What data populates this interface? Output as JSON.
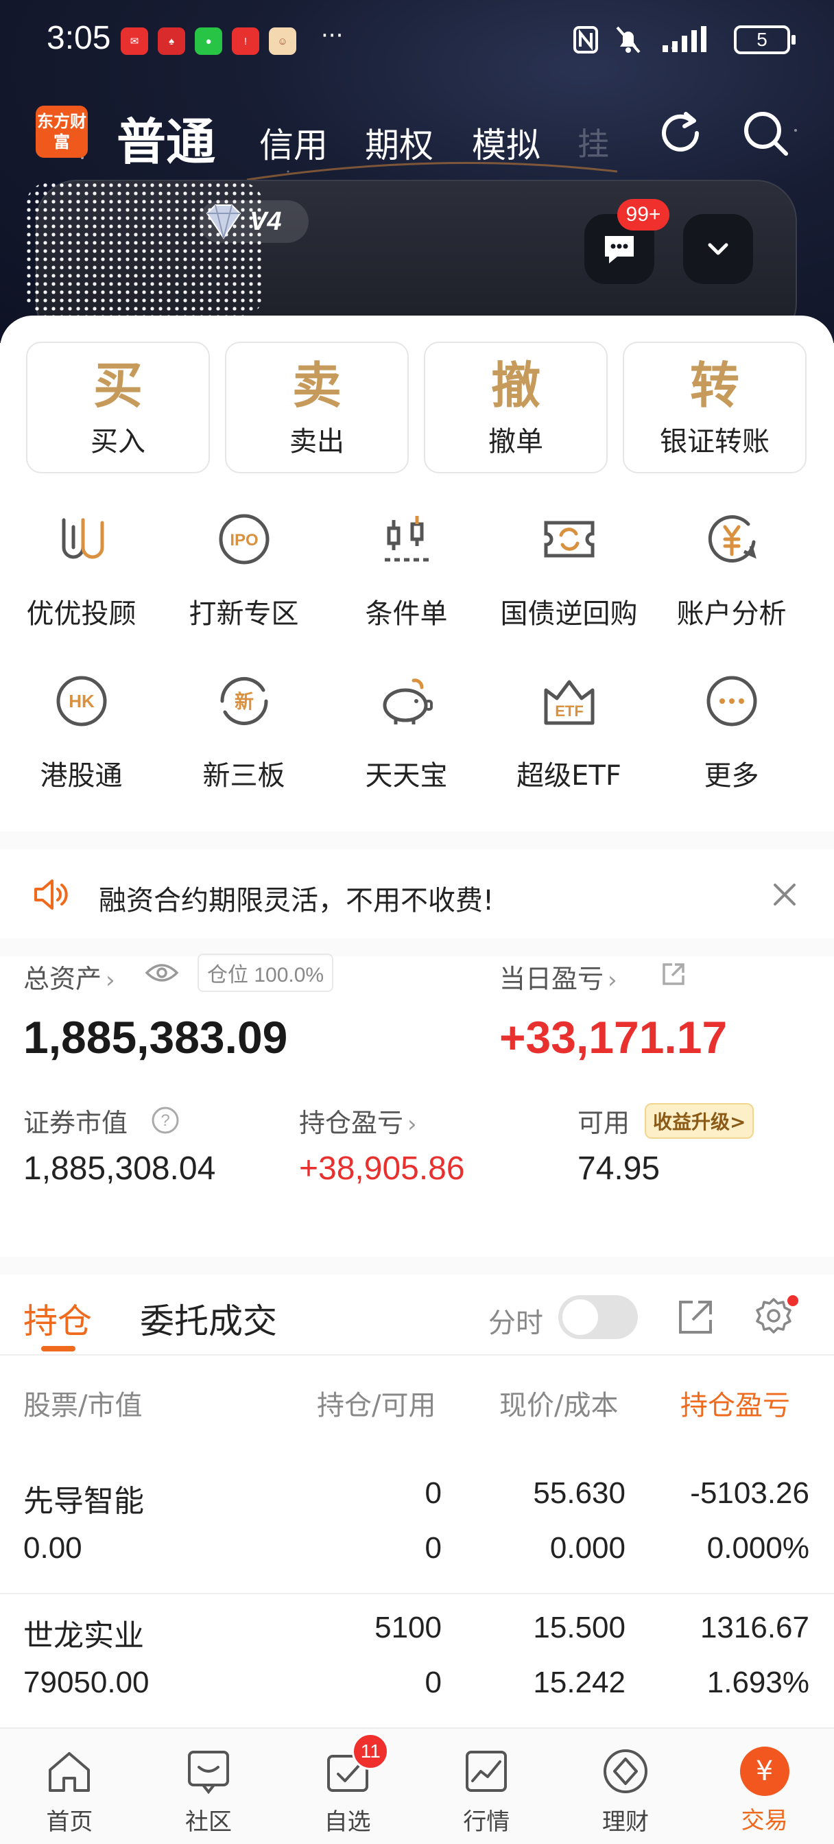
{
  "status_bar": {
    "time": "3:05",
    "apps": [
      {
        "name": "huawei-app-icon",
        "label": "HUAWEI",
        "color": "#e8302f"
      },
      {
        "name": "poker-app-icon",
        "label": "扑克",
        "color": "#d92b2b"
      },
      {
        "name": "wechat-icon",
        "label": "微",
        "color": "#28c445"
      },
      {
        "name": "alert-app-icon",
        "label": "!",
        "color": "#e8302f"
      },
      {
        "name": "game-app-icon",
        "label": "猫",
        "color": "#f4d8b0"
      }
    ],
    "more": "···",
    "battery": "5"
  },
  "header": {
    "logo": "东方财富",
    "tabs": [
      "普通",
      "信用",
      "期权",
      "模拟"
    ],
    "faded_tab": "挂"
  },
  "account": {
    "vip_level": "V4",
    "message_badge": "99+"
  },
  "quick_actions": [
    {
      "glyph": "买",
      "label": "买入"
    },
    {
      "glyph": "卖",
      "label": "卖出"
    },
    {
      "glyph": "撤",
      "label": "撤单"
    },
    {
      "glyph": "转",
      "label": "银证转账"
    }
  ],
  "grid": [
    [
      {
        "label": "优优投顾",
        "icon": "uu-advisor-icon"
      },
      {
        "label": "打新专区",
        "icon": "ipo-icon"
      },
      {
        "label": "条件单",
        "icon": "candlestick-icon"
      },
      {
        "label": "国债逆回购",
        "icon": "bond-repo-icon"
      },
      {
        "label": "账户分析",
        "icon": "yuan-analysis-icon"
      }
    ],
    [
      {
        "label": "港股通",
        "icon": "hk-icon"
      },
      {
        "label": "新三板",
        "icon": "new-board-icon"
      },
      {
        "label": "天天宝",
        "icon": "piggy-bank-icon"
      },
      {
        "label": "超级ETF",
        "icon": "etf-crown-icon"
      },
      {
        "label": "更多",
        "icon": "more-dots-icon"
      }
    ]
  ],
  "notice": {
    "text": "融资合约期限灵活，不用不收费!"
  },
  "assets": {
    "total_label": "总资产",
    "position_chip": "仓位 100.0%",
    "total_value": "1,885,383.09",
    "daily_label": "当日盈亏",
    "daily_value": "+33,171.17",
    "market_label": "证券市值",
    "market_value": "1,885,308.04",
    "hold_pl_label": "持仓盈亏",
    "hold_pl_value": "+38,905.86",
    "available_label": "可用",
    "upgrade_chip": "收益升级>",
    "available_value": "74.95"
  },
  "holdings_tabs": {
    "active": "持仓",
    "other": "委托成交",
    "timeshare_label": "分时"
  },
  "table": {
    "headers": [
      "股票/市值",
      "持仓/可用",
      "现价/成本",
      "持仓盈亏"
    ],
    "rows": [
      {
        "name": "先导智能",
        "market_value": "0.00",
        "position": "0",
        "available": "0",
        "price": "55.630",
        "cost": "0.000",
        "pl": "-5103.26",
        "pl_pct": "0.000%",
        "trend": "down"
      },
      {
        "name": "世龙实业",
        "market_value": "79050.00",
        "position": "5100",
        "available": "0",
        "price": "15.500",
        "cost": "15.242",
        "pl": "1316.67",
        "pl_pct": "1.693%",
        "trend": "up"
      }
    ]
  },
  "bottom_nav": {
    "items": [
      {
        "label": "首页",
        "icon": "home-icon"
      },
      {
        "label": "社区",
        "icon": "community-icon"
      },
      {
        "label": "自选",
        "icon": "watchlist-icon",
        "badge": "11"
      },
      {
        "label": "行情",
        "icon": "market-chart-icon"
      },
      {
        "label": "理财",
        "icon": "wealth-diamond-icon"
      },
      {
        "label": "交易",
        "icon": "trade-yuan-icon"
      }
    ]
  },
  "colors": {
    "accent": "#ef6a1c",
    "up": "#e8302f",
    "down": "#1a9a3d",
    "gold": "#c69a5b"
  }
}
